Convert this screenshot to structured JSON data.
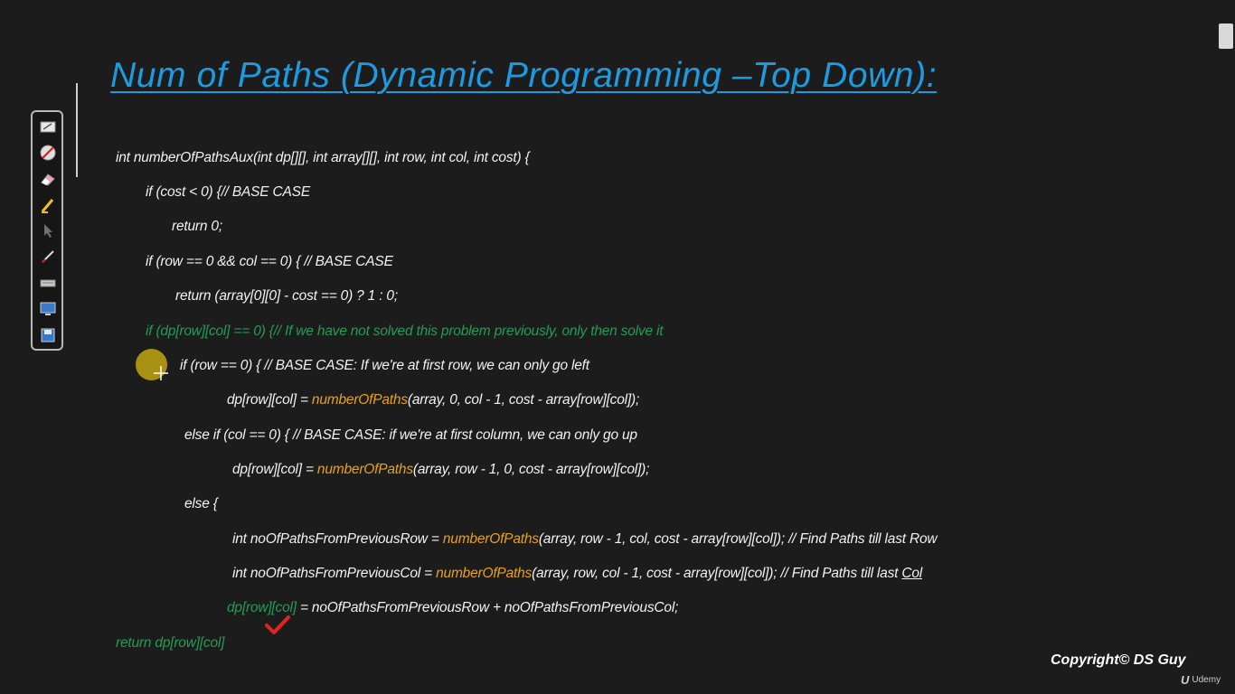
{
  "title": "Num of Paths (Dynamic Programming –Top Down):",
  "code": {
    "line1": "int numberOfPathsAux(int dp[][], int array[][], int row, int col, int cost) {",
    "line2": "if (cost < 0) {// BASE CASE",
    "line3": "return 0;",
    "line4": "if (row == 0 && col == 0) { // BASE CASE",
    "line5": "return (array[0][0] - cost == 0) ? 1 : 0;",
    "line6": "if (dp[row][col] == 0) {// If we have not solved this problem previously, only then solve it",
    "line7": "if (row == 0) { // BASE CASE: If we're at first row, we can only go left",
    "line8_pre": "dp[row][col] = ",
    "line8_fn": "numberOfPaths",
    "line8_post": "(array, 0, col - 1, cost - array[row][col]);",
    "line9": "else if (col == 0) { // BASE CASE: if we're at first column, we can only go up",
    "line10_pre": "dp[row][col] = ",
    "line10_fn": "numberOfPaths",
    "line10_post": "(array, row - 1, 0, cost - array[row][col]);",
    "line11": "else {",
    "line12_pre": "int noOfPathsFromPreviousRow = ",
    "line12_fn": "numberOfPaths",
    "line12_post": "(array, row - 1, col, cost - array[row][col]); // Find Paths till last Row",
    "line13_pre": "int noOfPathsFromPreviousCol = ",
    "line13_fn": "numberOfPaths",
    "line13_post": "(array, row, col - 1, cost - array[row][col]); // Find Paths till last ",
    "line13_ul": "Col",
    "line14_green": "dp[row][col]",
    "line14_post": " = noOfPathsFromPreviousRow + noOfPathsFromPreviousCol;",
    "line15": "return dp[row][col]"
  },
  "copyright": "Copyright© DS Guy",
  "udemy": "Udemy",
  "udemy_logo": "U",
  "colors": {
    "background": "#1c1c1c",
    "title": "#1e9be0",
    "function": "#e8a214",
    "green": "#1f9e55",
    "check": "#e82020",
    "cursor": "#a89012"
  },
  "toolbar_icons": [
    "whiteboard-icon",
    "no-pen-icon",
    "eraser-icon",
    "highlighter-icon",
    "pointer-icon",
    "pen-icon",
    "keyboard-icon",
    "screen-icon",
    "save-icon"
  ]
}
